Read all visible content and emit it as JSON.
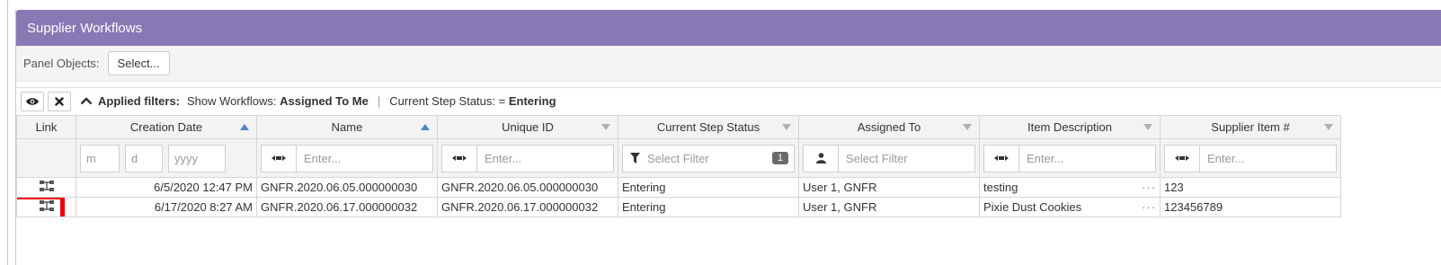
{
  "panel": {
    "title": "Supplier Workflows",
    "objects_label": "Panel Objects:",
    "select_button": "Select..."
  },
  "filters": {
    "applied_label": "Applied filters:",
    "f1_prefix": "Show Workflows:",
    "f1_value": "Assigned To Me",
    "separator": "|",
    "f2_prefix": "Current Step Status: =",
    "f2_value": "Entering"
  },
  "columns": {
    "link": "Link",
    "creation_date": "Creation Date",
    "name": "Name",
    "unique_id": "Unique ID",
    "status": "Current Step Status",
    "assigned": "Assigned To",
    "item_desc": "Item Description",
    "supplier_item": "Supplier Item #"
  },
  "filter_inputs": {
    "month_placeholder": "m",
    "day_placeholder": "d",
    "year_placeholder": "yyyy",
    "enter_placeholder": "Enter...",
    "select_filter_placeholder": "Select Filter",
    "status_badge": "1"
  },
  "rows": [
    {
      "creation_date": "6/5/2020 12:47 PM",
      "name": "GNFR.2020.06.05.000000030",
      "unique_id": "GNFR.2020.06.05.000000030",
      "status": "Entering",
      "assigned": "User 1, GNFR",
      "item_desc": "testing",
      "supplier_item": "123"
    },
    {
      "creation_date": "6/17/2020 8:27 AM",
      "name": "GNFR.2020.06.17.000000032",
      "unique_id": "GNFR.2020.06.17.000000032",
      "status": "Entering",
      "assigned": "User 1, GNFR",
      "item_desc": "Pixie Dust Cookies",
      "supplier_item": "123456789"
    }
  ],
  "ellipsis": "···",
  "colors": {
    "header_bg": "#8878b3",
    "highlight": "#ee0000",
    "sort_active": "#4a86c8",
    "sort_inactive": "#b0b0b0"
  },
  "icons": [
    "eye-icon",
    "close-icon",
    "chevron-up-icon",
    "filter-icon",
    "user-icon",
    "sort-asc-icon",
    "sort-desc-icon",
    "link-icon",
    "range-icon"
  ]
}
